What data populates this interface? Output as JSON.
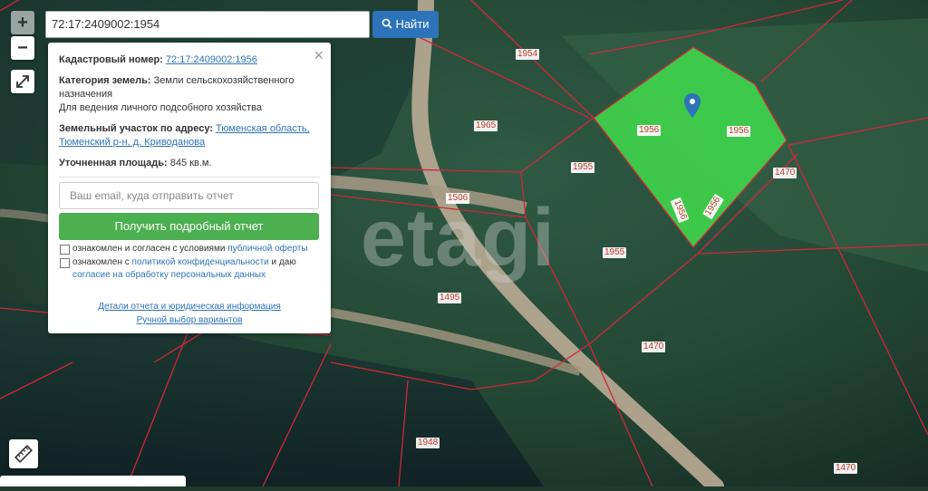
{
  "search": {
    "value": "72:17:2409002:1954",
    "button_label": "Найти"
  },
  "zoom": {
    "in": "+",
    "out": "−"
  },
  "popup": {
    "close": "×",
    "cadastral_label": "Кадастровый номер:",
    "cadastral_value": "72:17:2409002:1956",
    "category_label": "Категория земель:",
    "category_value": "Земли сельскохозяйственного назначения",
    "usage": "Для ведения личного подсобного хозяйства",
    "address_label": "Земельный участок по адресу:",
    "address_value_1": "Тюменская область,",
    "address_value_2": "Тюменский р-н, д. Криводанова",
    "area_label": "Уточненная площадь:",
    "area_value": "845 кв.м.",
    "email_placeholder": "Ваш email, куда отправить отчет",
    "report_button": "Получить подробный отчет",
    "consent1_text": "ознакомлен и согласен с условиями ",
    "consent1_link": "публичной оферты",
    "consent2_text": "ознакомлен с ",
    "consent2_link": "политикой конфиденциальности",
    "consent2_mid": " и даю",
    "consent2_link2": "согласие на обработку персональных данных",
    "details_link": "Детали отчета и юридическая информация",
    "manual_link": "Ручной выбор вариантов"
  },
  "watermark": "etagi",
  "plots": [
    "1954",
    "1965",
    "1955",
    "1956",
    "1956",
    "1470",
    "1506",
    "1956",
    "1956",
    "1955",
    "1495",
    "1470",
    "1948",
    "1470"
  ],
  "colors": {
    "selected_plot": "#3fd34c",
    "boundary": "#d0273a",
    "button_blue": "#2d73b9",
    "button_green": "#4caf50"
  }
}
